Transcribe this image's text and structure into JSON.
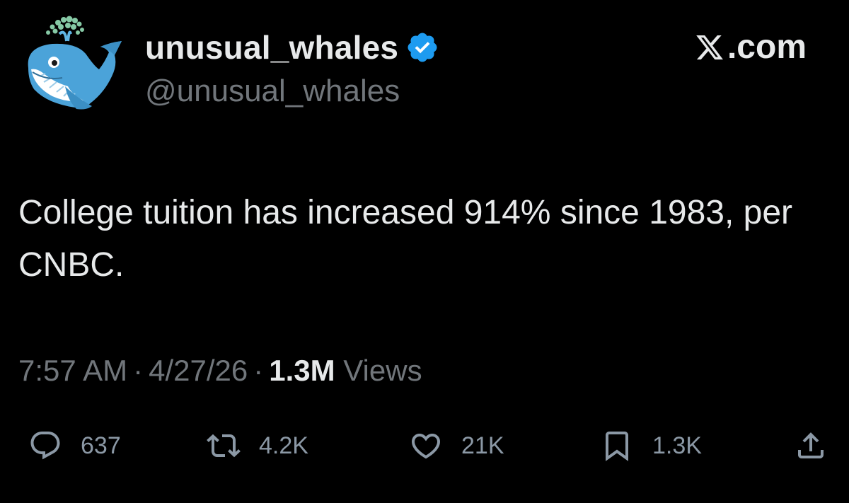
{
  "author": {
    "display_name": "unusual_whales",
    "handle": "@unusual_whales",
    "verified": true,
    "avatar_icon": "whale-icon",
    "verified_color": "#1d9bf0"
  },
  "source": {
    "logo": "x-logo-icon",
    "domain": ".com"
  },
  "tweet": {
    "text": "College tuition has increased 914% since 1983, per CNBC."
  },
  "meta": {
    "time": "7:57 AM",
    "separator": "·",
    "date": "4/27/26",
    "views_count": "1.3M",
    "views_label": " Views"
  },
  "actions": {
    "replies": {
      "icon": "reply-icon",
      "count": "637"
    },
    "reposts": {
      "icon": "repost-icon",
      "count": "4.2K"
    },
    "likes": {
      "icon": "heart-icon",
      "count": "21K"
    },
    "bookmarks": {
      "icon": "bookmark-icon",
      "count": "1.3K"
    },
    "share": {
      "icon": "share-icon"
    }
  },
  "colors": {
    "background": "#000000",
    "primary_text": "#e7e9ea",
    "secondary_text": "#71767b",
    "action_icon": "#8b98a5",
    "accent": "#1d9bf0"
  }
}
